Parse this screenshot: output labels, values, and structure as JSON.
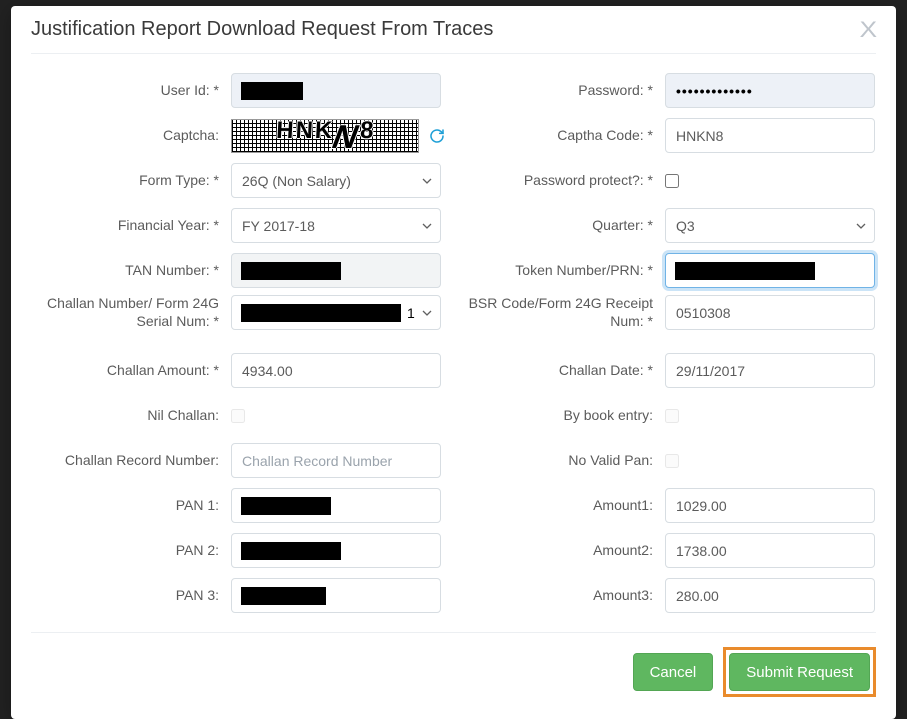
{
  "modal": {
    "title": "Justification Report Download Request From Traces",
    "close": "X"
  },
  "labels": {
    "user_id": "User Id: *",
    "password": "Password: *",
    "captcha": "Captcha:",
    "captcha_code": "Captha Code: *",
    "form_type": "Form Type: *",
    "password_protect": "Password protect?: *",
    "financial_year": "Financial Year: *",
    "quarter": "Quarter: *",
    "tan_number": "TAN Number: *",
    "token_number": "Token Number/PRN: *",
    "challan_serial": "Challan Number/ Form 24G Serial Num: *",
    "bsr_receipt": "BSR Code/Form 24G Receipt Num: *",
    "challan_amount": "Challan Amount: *",
    "challan_date": "Challan Date: *",
    "nil_challan": "Nil Challan:",
    "by_book": "By book entry:",
    "challan_record_num": "Challan Record Number:",
    "no_valid_pan": "No Valid Pan:",
    "pan1": "PAN 1:",
    "amount1": "Amount1:",
    "pan2": "PAN 2:",
    "amount2": "Amount2:",
    "pan3": "PAN 3:",
    "amount3": "Amount3:"
  },
  "values": {
    "captcha_display": "HNKN8",
    "captcha_code": "HNKN8",
    "form_type": "26Q (Non Salary)",
    "financial_year": "FY 2017-18",
    "quarter": "Q3",
    "bsr_receipt": "0510308",
    "challan_amount": "4934.00",
    "challan_date": "29/11/2017",
    "amount1": "1029.00",
    "amount2": "1738.00",
    "amount3": "280.00",
    "password_mask": "•••••••••••••",
    "challan_serial_suffix": "1"
  },
  "placeholders": {
    "challan_record_num": "Challan Record Number"
  },
  "buttons": {
    "cancel": "Cancel",
    "submit": "Submit Request"
  },
  "icons": {
    "refresh": "refresh-icon",
    "close": "close-icon"
  },
  "redactions": {
    "user_id_w": 62,
    "tan_number_w": 100,
    "token_number_w": 140,
    "challan_serial_w": 160,
    "pan1_w": 90,
    "pan2_w": 100,
    "pan3_w": 85
  }
}
